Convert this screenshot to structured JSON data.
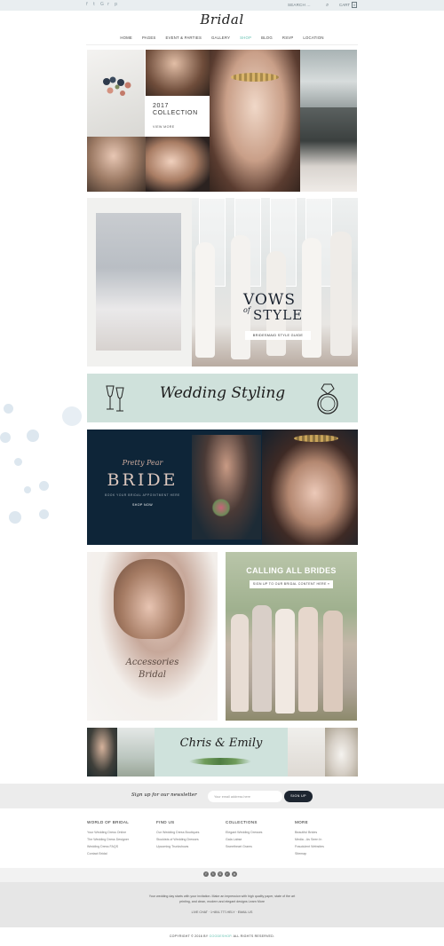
{
  "topbar": {
    "social_icons": [
      "facebook-icon",
      "twitter-icon",
      "google-plus-icon",
      "rss-icon",
      "pinterest-icon"
    ],
    "social_glyphs": [
      "f",
      "t",
      "G",
      "r",
      "p"
    ],
    "search_label": "SEARCH ...",
    "cart_label": "CART",
    "cart_count": "0"
  },
  "logo": "Bridal",
  "nav": {
    "items": [
      "HOME",
      "PAGES",
      "EVENT & PARTIES",
      "GALLERY",
      "SHOP",
      "BLOG",
      "RSVP",
      "LOCATION"
    ],
    "active": "SHOP",
    "active_color": "#5fbfae"
  },
  "collection": {
    "title_line1": "2017",
    "title_line2": "COLLECTION",
    "link": "VIEW MORE"
  },
  "vows": {
    "line1": "VOWS",
    "of": "of",
    "line2": "STYLE",
    "button": "BRIDESMAID STYLE GUIDE"
  },
  "wedding_styling": {
    "title": "Wedding Styling"
  },
  "pretty_pear": {
    "script": "Pretty Pear",
    "title": "BRIDE",
    "subtitle": "BOOK YOUR BRIDAL APPOINTMENT HERE",
    "cta": "SHOP NOW"
  },
  "accessories": {
    "line1": "Accessories",
    "line2": "Bridal"
  },
  "calling": {
    "title": "CALLING ALL BRIDES",
    "button": "SIGN UP TO OUR BRIDAL CONTENT HERE »"
  },
  "couple": {
    "names": "Chris & Emily"
  },
  "newsletter": {
    "label": "Sign up for our newsletter",
    "placeholder": "Your email address here",
    "button": "SIGN UP"
  },
  "footer": {
    "columns": [
      {
        "title": "WORLD OF BRIDAL",
        "links": [
          "Your Wedding Dress Online",
          "The Wedding Dress Designer",
          "Wedding Dress FAQS",
          "Contact Bridal"
        ]
      },
      {
        "title": "FIND US",
        "links": [
          "Our Wedding Dress Boutiques",
          "Stockists of Wedding Dresses",
          "Upcoming Trunkshows"
        ]
      },
      {
        "title": "COLLECTIONS",
        "links": [
          "Elegant Wedding Dresses",
          "Gala Labse",
          "Sweetheart Grams"
        ]
      },
      {
        "title": "MORE",
        "links": [
          "Beautiful Brides",
          "Media - As Seen In",
          "Fraudulent Websites",
          "Sitemap"
        ]
      }
    ]
  },
  "social_bar": {
    "icons": [
      "facebook-icon",
      "twitter-icon",
      "google-plus-icon",
      "rss-icon",
      "pinterest-icon"
    ],
    "glyphs": [
      "f",
      "t",
      "G",
      "r",
      "p"
    ]
  },
  "about": {
    "text": "Your wedding day starts with your invitation. Make an impression with high quality paper, state of the art printing, and clean, modern and elegant designs Learn More",
    "contact": "LIVE CHAT  ·  1+804-777-HELY  ·  EMAIL US"
  },
  "copyright": {
    "prefix": "COPYRIGHT © 2016 BY",
    "brand": "GOODESHOP",
    "suffix": ". ALL RIGHTS RESERVED."
  }
}
